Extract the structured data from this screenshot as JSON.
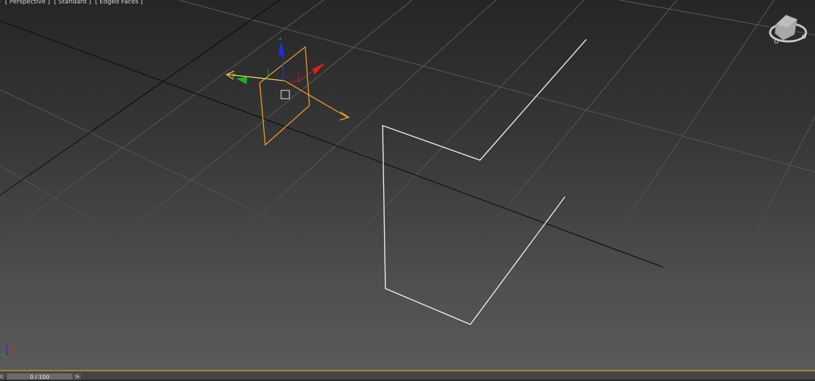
{
  "viewport": {
    "menu_plus": "+",
    "labels": [
      "[ Perspective ]",
      "[ Standard ]",
      "[ Edged Faces ]"
    ],
    "view_type": "perspective",
    "colors": {
      "grid": "#5e5e5e",
      "world_axis": "#0a0a0a",
      "spline": "#f2f2f2",
      "selection": "#f0a030",
      "axis_x": "#e02020",
      "axis_y": "#20b020",
      "axis_z": "#2030e0"
    },
    "gizmo": {
      "x_label": "x",
      "y_label": "y",
      "z_label": "z"
    },
    "viewcube_icon": "viewcube-icon",
    "corner_axis": {
      "z_label": "z",
      "x_label": "x"
    }
  },
  "timeline": {
    "prev_label": "<",
    "next_label": ">",
    "frame_text": "0 / 100",
    "current_frame": 0,
    "total_frames": 100
  }
}
